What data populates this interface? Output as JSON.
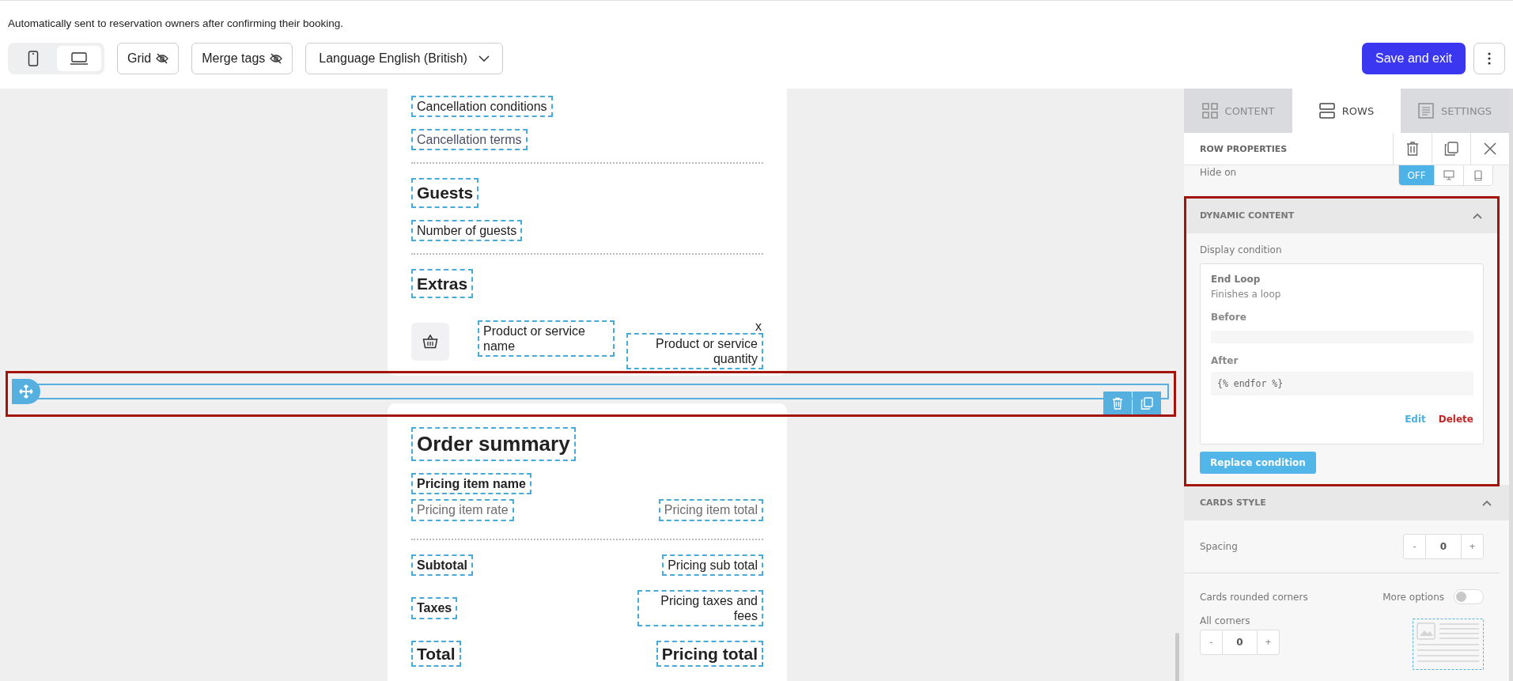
{
  "description": "Automatically sent to reservation owners after confirming their booking.",
  "toolbar": {
    "devices": [
      {
        "kind": "mobile",
        "selected": false
      },
      {
        "kind": "desktop",
        "selected": true
      }
    ],
    "toggles": [
      "Grid",
      "Merge tags"
    ],
    "language": {
      "label": "Language",
      "value": "English (British)"
    },
    "save_button": "Save and exit"
  },
  "email": {
    "upper_blocks": [
      {
        "kind": "text",
        "text": "Cancellation conditions"
      },
      {
        "kind": "muted",
        "text": "Cancellation terms"
      },
      {
        "kind": "divider"
      },
      {
        "kind": "heading",
        "text": "Guests"
      },
      {
        "kind": "text",
        "text": "Number of guests"
      },
      {
        "kind": "divider"
      },
      {
        "kind": "heading",
        "text": "Extras"
      },
      {
        "kind": "product",
        "name": "Product or service name",
        "multiplier": "x",
        "quantity": "Product or service quantity"
      }
    ],
    "lower_blocks": [
      {
        "kind": "title",
        "text": "Order summary"
      },
      {
        "kind": "label",
        "text": "Pricing item name"
      },
      {
        "kind": "muted_pair",
        "left": "Pricing item rate",
        "right": "Pricing item total"
      },
      {
        "kind": "divider"
      },
      {
        "kind": "pair",
        "left": "Subtotal",
        "right": "Pricing sub total"
      },
      {
        "kind": "pair",
        "left": "Taxes",
        "right": "Pricing taxes and fees"
      },
      {
        "kind": "total_pair",
        "left": "Total",
        "right": "Pricing total"
      }
    ]
  },
  "panel": {
    "tabs": [
      {
        "label": "CONTENT",
        "selected": false
      },
      {
        "label": "ROWS",
        "selected": true
      },
      {
        "label": "SETTINGS",
        "selected": false
      }
    ],
    "header": "ROW PROPERTIES",
    "hide_on": {
      "label": "Hide on",
      "options": [
        {
          "kind": "off",
          "label": "OFF",
          "selected": true
        },
        {
          "kind": "desktop",
          "selected": false
        },
        {
          "kind": "mobile",
          "selected": false
        }
      ]
    },
    "dynamic_content": {
      "title": "DYNAMIC CONTENT",
      "expanded": true,
      "label": "Display condition",
      "condition": {
        "name": "End Loop",
        "description": "Finishes a loop",
        "before_label": "Before",
        "after_label": "After",
        "after_value": "{% endfor %}",
        "edit": "Edit",
        "delete": "Delete"
      },
      "replace_button": "Replace condition"
    },
    "cards_style": {
      "title": "CARDS STYLE",
      "expanded": true,
      "spacing": {
        "label": "Spacing",
        "minus": "-",
        "value": "0",
        "plus": "+"
      },
      "rounded": {
        "label": "Cards rounded corners",
        "more_options": "More options",
        "more_options_on": false,
        "all_corners": "All corners",
        "minus": "-",
        "value": "0",
        "plus": "+"
      }
    }
  }
}
